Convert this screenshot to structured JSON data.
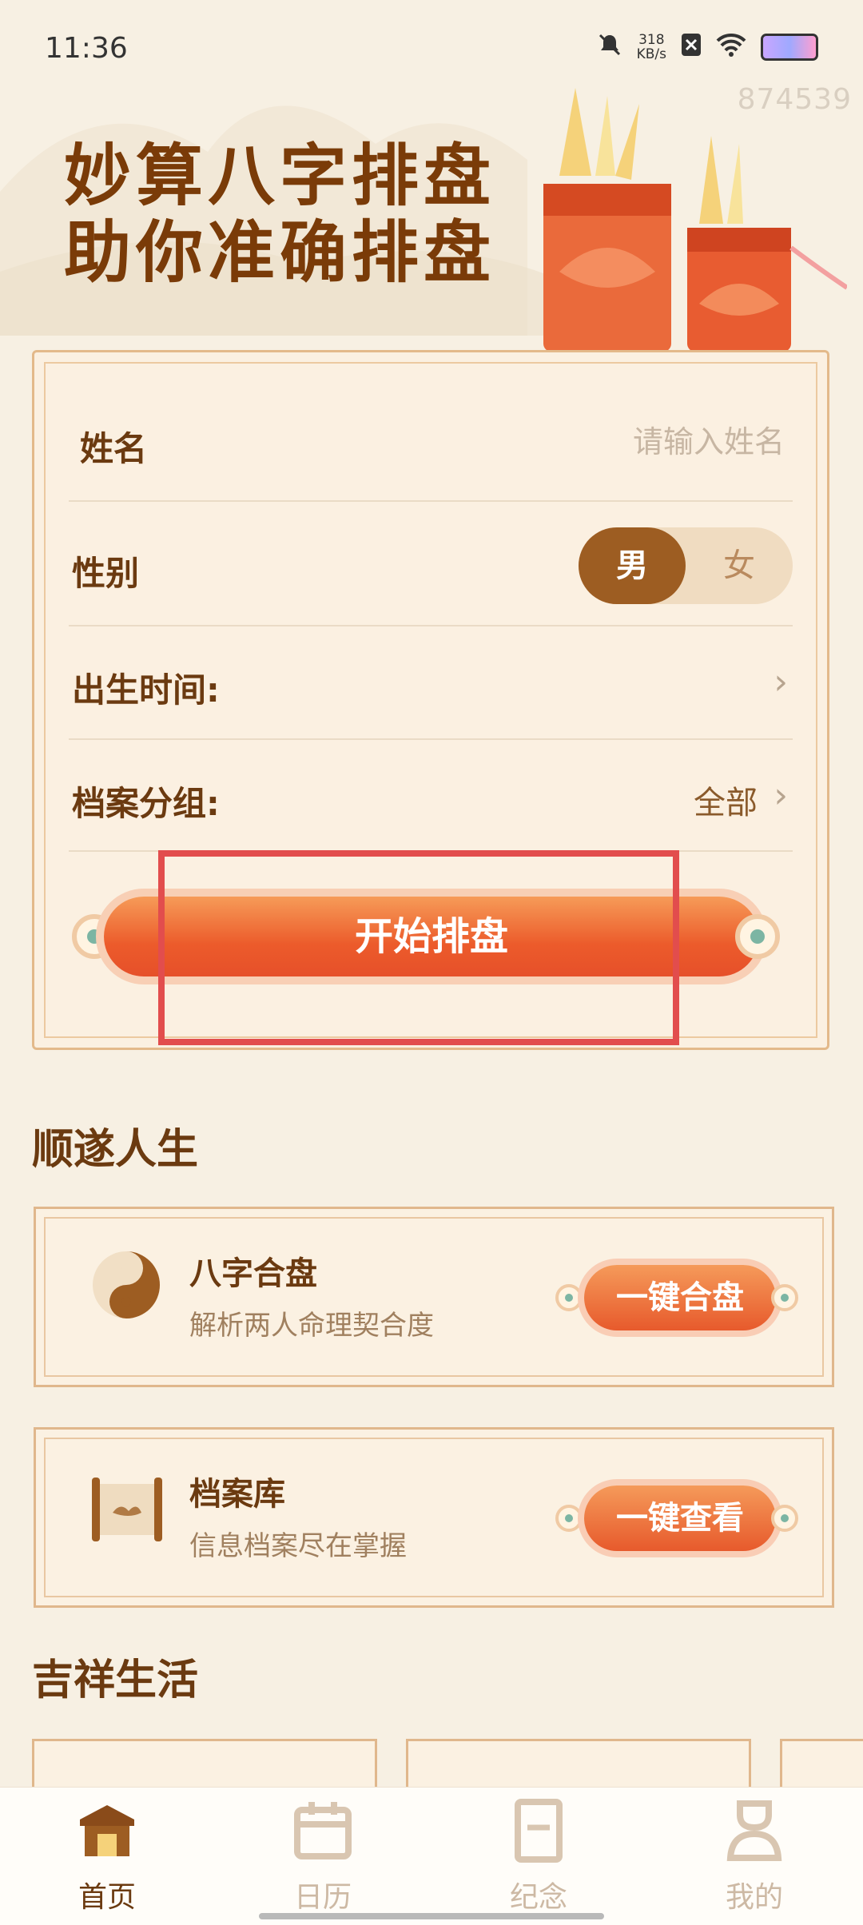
{
  "status_bar": {
    "time": "11:36",
    "net_speed": "318",
    "net_unit": "KB/s"
  },
  "header": {
    "user_id": "874539",
    "headline_line1": "妙算八字排盘",
    "headline_line2": "助你准确排盘"
  },
  "form": {
    "name_label": "姓名",
    "name_placeholder": "请输入姓名",
    "gender_label": "性别",
    "gender_male": "男",
    "gender_female": "女",
    "gender_selected": "男",
    "birth_label": "出生时间:",
    "group_label": "档案分组:",
    "group_value": "全部",
    "start_button": "开始排盘"
  },
  "section1": {
    "title": "顺遂人生",
    "cards": [
      {
        "title": "八字合盘",
        "subtitle": "解析两人命理契合度",
        "button": "一键合盘",
        "icon": "yin-yang-icon"
      },
      {
        "title": "档案库",
        "subtitle": "信息档案尽在掌握",
        "button": "一键查看",
        "icon": "scroll-icon"
      }
    ]
  },
  "section2": {
    "title": "吉祥生活"
  },
  "tabbar": {
    "items": [
      {
        "label": "首页",
        "icon": "home-icon",
        "active": true
      },
      {
        "label": "日历",
        "icon": "calendar-icon",
        "active": false
      },
      {
        "label": "纪念",
        "icon": "memorial-icon",
        "active": false
      },
      {
        "label": "我的",
        "icon": "profile-icon",
        "active": false
      }
    ]
  },
  "colors": {
    "accent": "#ec5b2b",
    "brown": "#6b3a10",
    "background": "#f7f0e3",
    "highlight": "#e24d4d"
  }
}
